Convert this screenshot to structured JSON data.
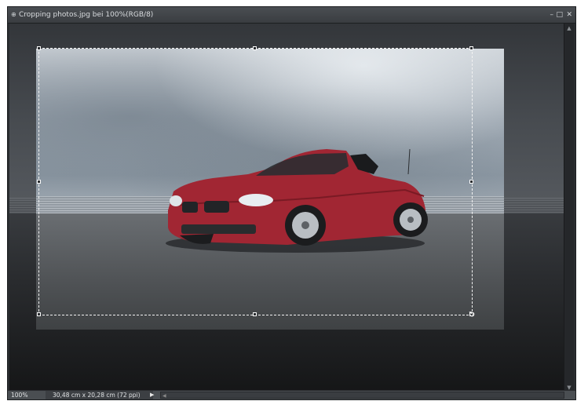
{
  "window": {
    "title": "Cropping photos.jpg bei 100%(RGB/8)",
    "doc_icon": "document-icon",
    "controls": [
      "minimize",
      "maximize",
      "close"
    ]
  },
  "status": {
    "zoom": "100%",
    "document_info": "30,48 cm x 20,28 cm (72 ppi)"
  },
  "glyphs": {
    "doc": "⊕",
    "min": "–",
    "max": "□",
    "close": "✕",
    "play": "▶",
    "left": "◀",
    "up": "▲",
    "down": "▼",
    "rotate": "↻"
  },
  "colors": {
    "car": "#a12633",
    "crop_border": "#f2f2f2",
    "ui_background": "#2a2d30"
  }
}
